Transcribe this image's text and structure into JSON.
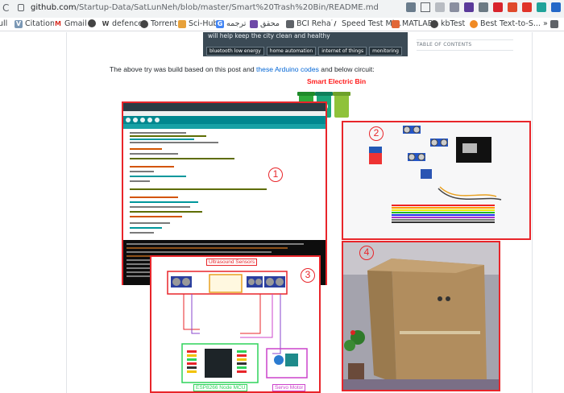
{
  "browser": {
    "url_host": "github.com",
    "url_path": "/Startup-Data/SatLunNeh/blob/master/Smart%20Trash%20Bin/README.md",
    "bookmarks": [
      {
        "label": "ull",
        "icon": "apps-icon"
      },
      {
        "label": "Citation",
        "icon": "citation-icon"
      },
      {
        "label": "Gmail",
        "icon": "gmail-icon"
      },
      {
        "label": "",
        "icon": "globe-icon"
      },
      {
        "label": "defence",
        "icon": "w-icon"
      },
      {
        "label": "Torrent",
        "icon": "globe-icon"
      },
      {
        "label": "Sci-Hub",
        "icon": "scihub-icon"
      },
      {
        "label": "ترجمه",
        "icon": "translate-icon"
      },
      {
        "label": "محقق",
        "icon": "mohaghegh-icon"
      },
      {
        "label": "BCI Rehab",
        "icon": "folder-icon"
      },
      {
        "label": "Speed Test Mi...",
        "icon": "speedtest-icon"
      },
      {
        "label": "MATLAB",
        "icon": "matlab-icon"
      },
      {
        "label": "kbTest",
        "icon": "globe-icon"
      },
      {
        "label": "Best Text-to-S...",
        "icon": "tts-icon"
      }
    ]
  },
  "page": {
    "banner_text": "will help keep the city clean and healthy",
    "banner_tags": [
      "bluetooth low energy",
      "home automation",
      "internet of things",
      "monitoring"
    ],
    "toc_label": "TABLE OF CONTENTS",
    "paragraph": {
      "before": "The above try was build based on this post and ",
      "link": "these Arduino codes",
      "after": " and below circuit:"
    },
    "figure": {
      "title": "Smart Electric Bin",
      "panel_numbers": [
        "1",
        "2",
        "3",
        "4"
      ],
      "schematic": {
        "sensors_label": "Ultrasound Sensors",
        "mcu_label": "ESP8266 Node MCU",
        "servo_label": "Servo Motor"
      }
    }
  },
  "colors": {
    "accent_red": "#e8252a",
    "link_blue": "#0366d6",
    "ide_teal": "#00878f"
  }
}
